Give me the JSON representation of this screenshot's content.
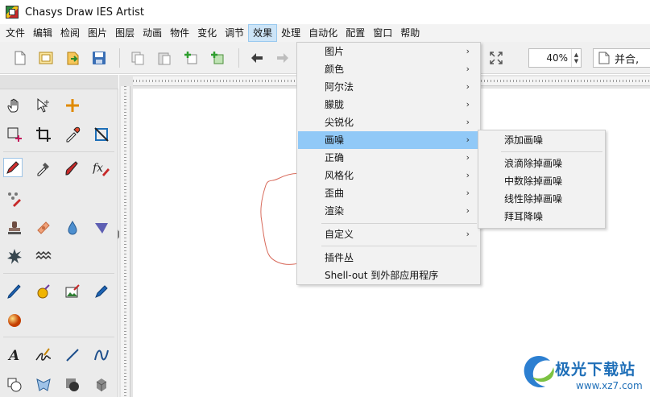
{
  "window": {
    "title": "Chasys Draw IES Artist"
  },
  "menubar": {
    "items": [
      "文件",
      "编辑",
      "检阅",
      "图片",
      "图层",
      "动画",
      "物件",
      "变化",
      "调节",
      "效果",
      "处理",
      "自动化",
      "配置",
      "窗口",
      "帮助"
    ],
    "active": "效果"
  },
  "toolbar": {
    "zoom": {
      "value": "40%"
    },
    "merge_label": "并合,"
  },
  "effects_menu": {
    "items": [
      {
        "label": "图片",
        "submenu": true
      },
      {
        "label": "颜色",
        "submenu": true
      },
      {
        "label": "阿尔法",
        "submenu": true
      },
      {
        "label": "朦胧",
        "submenu": true
      },
      {
        "label": "尖锐化",
        "submenu": true
      },
      {
        "label": "画噪",
        "submenu": true,
        "highlighted": true
      },
      {
        "label": "正确",
        "submenu": true
      },
      {
        "label": "风格化",
        "submenu": true
      },
      {
        "label": "歪曲",
        "submenu": true
      },
      {
        "label": "渲染",
        "submenu": true
      }
    ],
    "custom": {
      "label": "自定义",
      "submenu": true
    },
    "plugins": {
      "label": "插件丛"
    },
    "shell_out": {
      "label": "Shell-out 到外部应用程序"
    },
    "arrow_glyph": "›"
  },
  "noise_submenu": {
    "add": "添加画噪",
    "items": [
      "浪滴除掉画噪",
      "中数除掉画噪",
      "线性除掉画噪",
      "拜耳降噪"
    ]
  },
  "watermark": {
    "brand": "极光下载站",
    "url": "www.xz7.com"
  },
  "colors": {
    "menu_highlight": "#91c9f7",
    "active_menu": "#cce4f7",
    "accent_blue": "#1f6fb8"
  }
}
